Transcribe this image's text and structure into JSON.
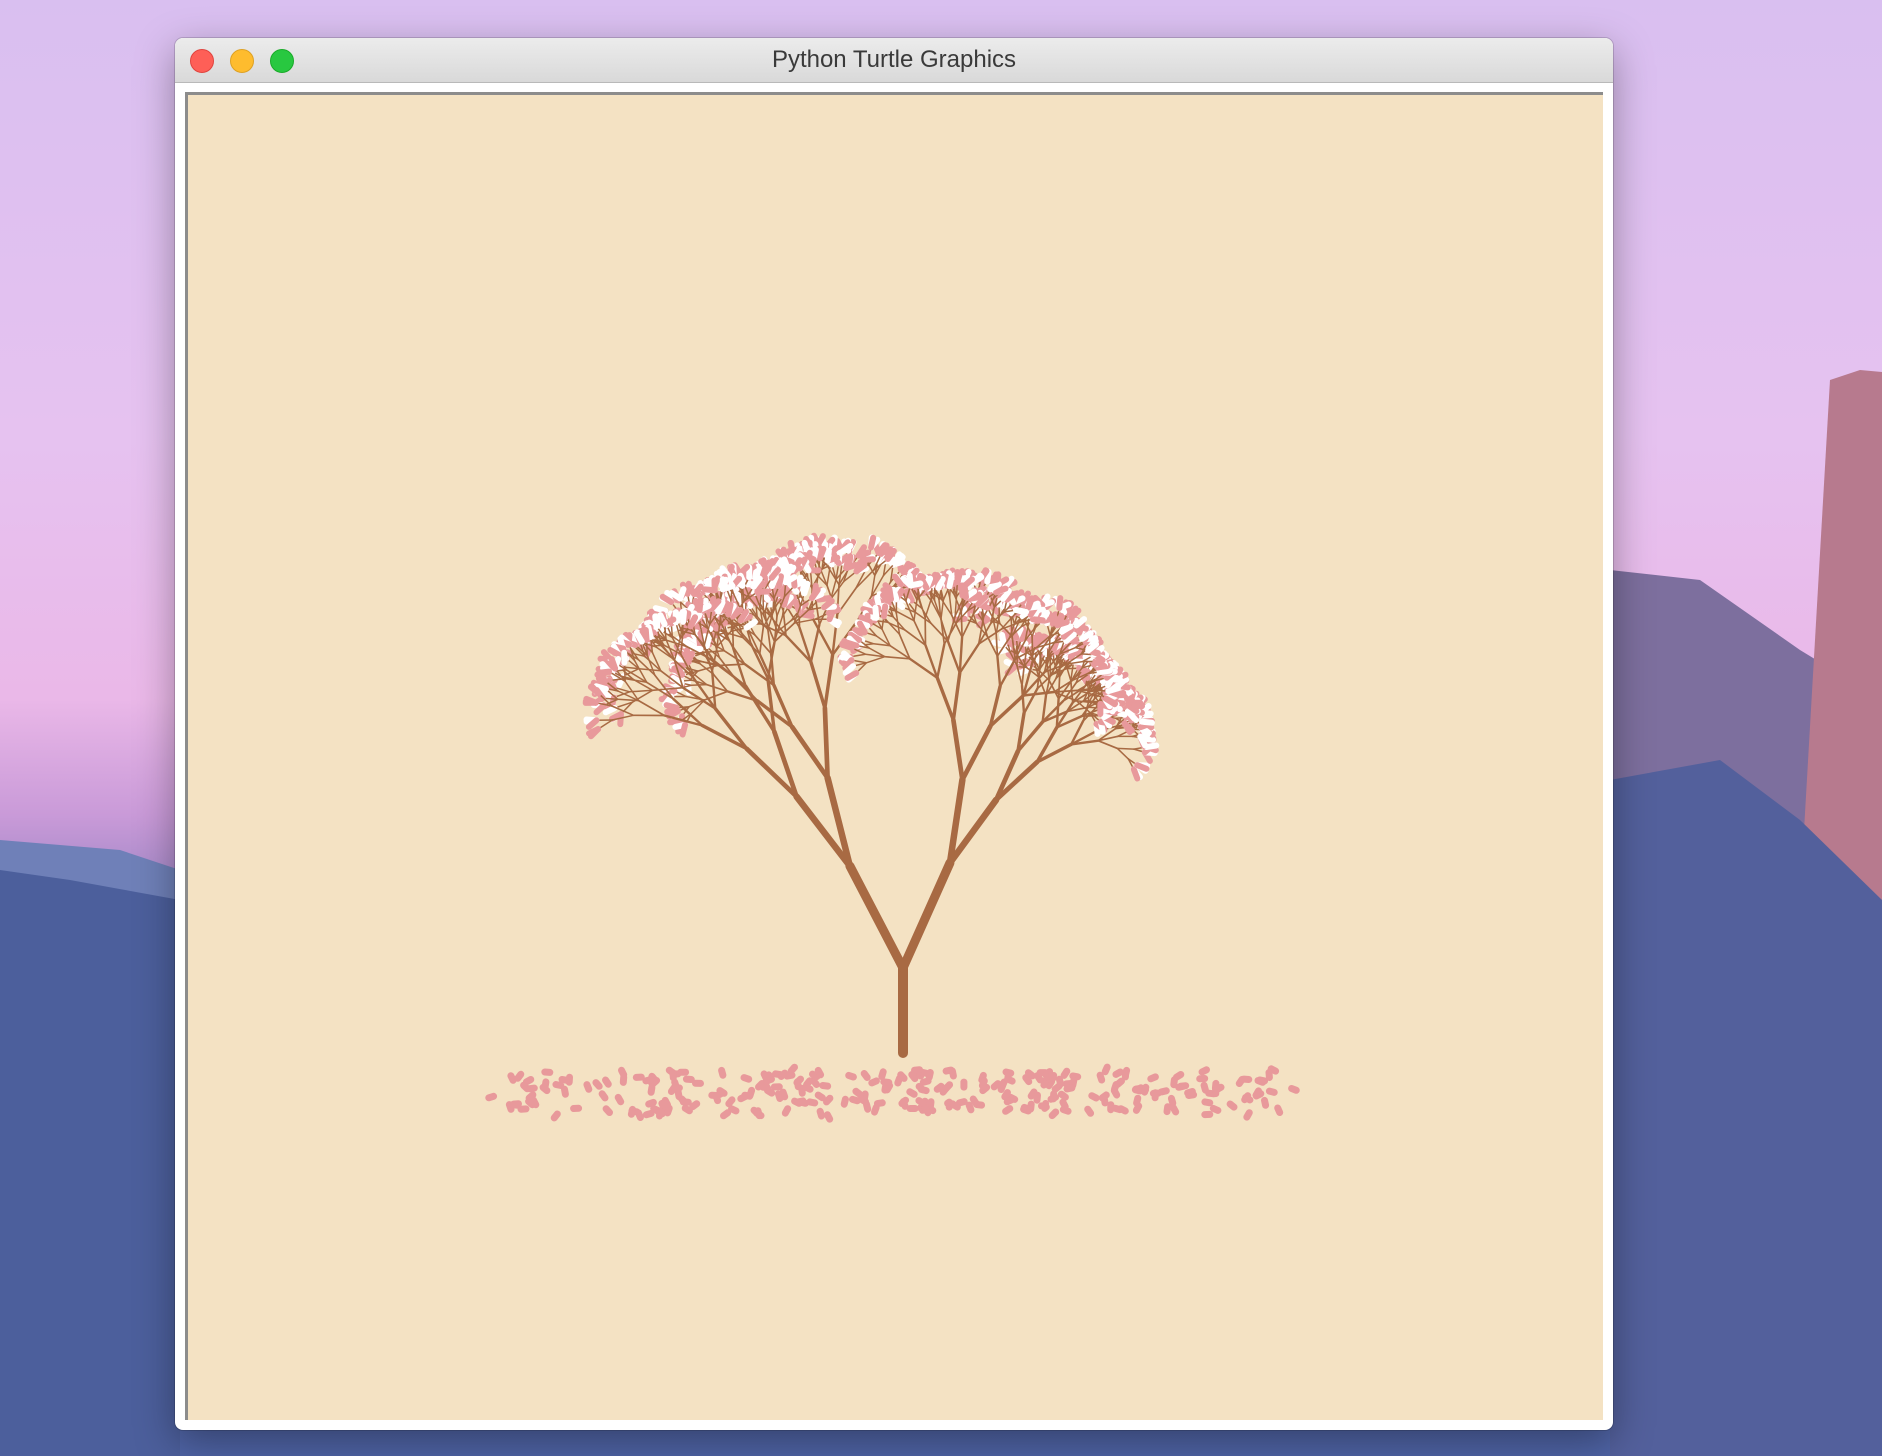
{
  "window": {
    "title": "Python Turtle Graphics"
  },
  "colors": {
    "canvas_background": "#f4e2c3",
    "branch": "#a86a43",
    "petal_pink": "#e8999b",
    "petal_white": "#ffffff"
  },
  "icons": [
    "close-icon",
    "minimize-icon",
    "zoom-icon"
  ]
}
